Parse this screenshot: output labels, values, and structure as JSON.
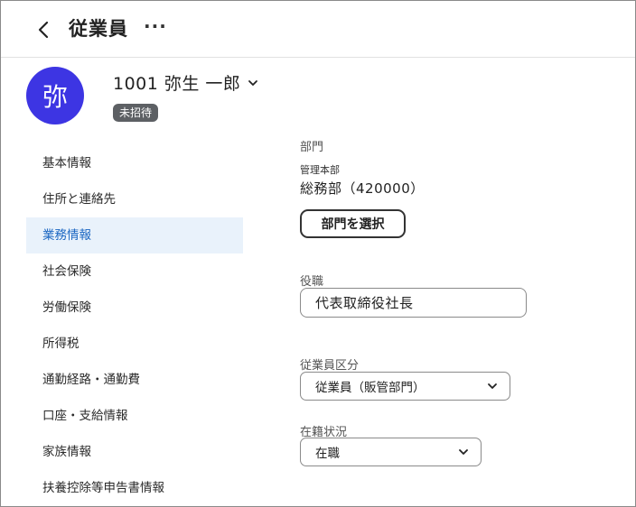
{
  "header": {
    "title": "従業員",
    "more_label": "···"
  },
  "employee": {
    "avatar_char": "弥",
    "avatar_color": "#3d35e3",
    "name": "1001 弥生 一郎",
    "status": "未招待"
  },
  "sidebar": {
    "items": [
      {
        "label": "基本情報",
        "active": false
      },
      {
        "label": "住所と連絡先",
        "active": false
      },
      {
        "label": "業務情報",
        "active": true
      },
      {
        "label": "社会保険",
        "active": false
      },
      {
        "label": "労働保険",
        "active": false
      },
      {
        "label": "所得税",
        "active": false
      },
      {
        "label": "通勤経路・通勤費",
        "active": false
      },
      {
        "label": "口座・支給情報",
        "active": false
      },
      {
        "label": "家族情報",
        "active": false
      },
      {
        "label": "扶養控除等申告書情報",
        "active": false
      }
    ],
    "active_color": "#1a66c2"
  },
  "form": {
    "department": {
      "label": "部門",
      "parent": "管理本部",
      "value": "総務部（420000）",
      "button_label": "部門を選択"
    },
    "position": {
      "label": "役職",
      "value": "代表取締役社長"
    },
    "employee_type": {
      "label": "従業員区分",
      "selected": "従業員（販管部門）"
    },
    "employment_status": {
      "label": "在籍状況",
      "selected": "在職"
    }
  }
}
